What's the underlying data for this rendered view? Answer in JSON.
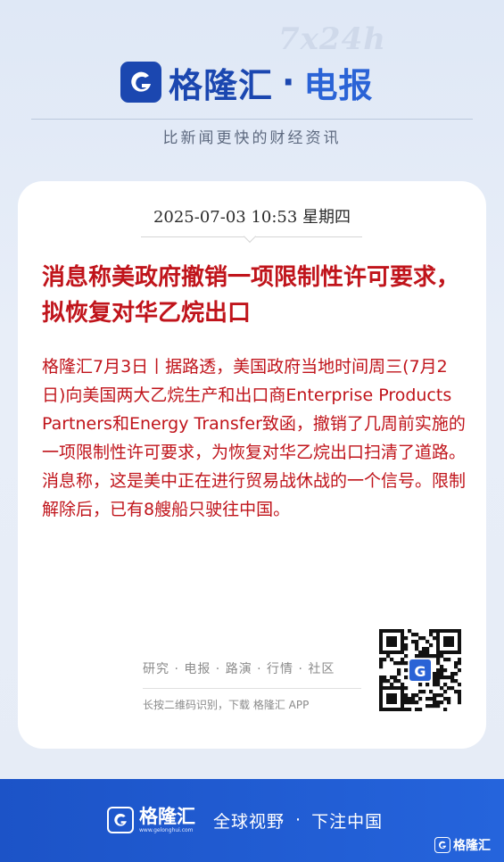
{
  "header": {
    "watermark": "7x24h",
    "brand_name": "格隆汇",
    "dot": "·",
    "brand_sub": "电报",
    "tagline": "比新闻更快的财经资讯"
  },
  "article": {
    "datetime": "2025-07-03 10:53 星期四",
    "headline": "消息称美政府撤销一项限制性许可要求，拟恢复对华乙烷出口",
    "body": "格隆汇7月3日丨据路透，美国政府当地时间周三(7月2日)向美国两大乙烷生产和出口商Enterprise Products Partners和Energy Transfer致函，撤销了几周前实施的一项限制性许可要求，为恢复对华乙烷出口扫清了道路。消息称，这是美中正在进行贸易战休战的一个信号。限制解除后，已有8艘船只驶往中国。"
  },
  "footer": {
    "links": "研究 · 电报 · 路演 · 行情 · 社区",
    "hint": "长按二维码识别，下载 格隆汇 APP",
    "qr_icon": "qr-code-icon"
  },
  "band": {
    "brand": "格隆汇",
    "url": "www.gelonghui.com",
    "slogan_1": "全球视野",
    "dot": "·",
    "slogan_2": "下注中国",
    "corner": "格隆汇"
  },
  "colors": {
    "brand_blue": "#1b47b0",
    "headline_red": "#c0141b",
    "band_blue": "#2564dc"
  }
}
